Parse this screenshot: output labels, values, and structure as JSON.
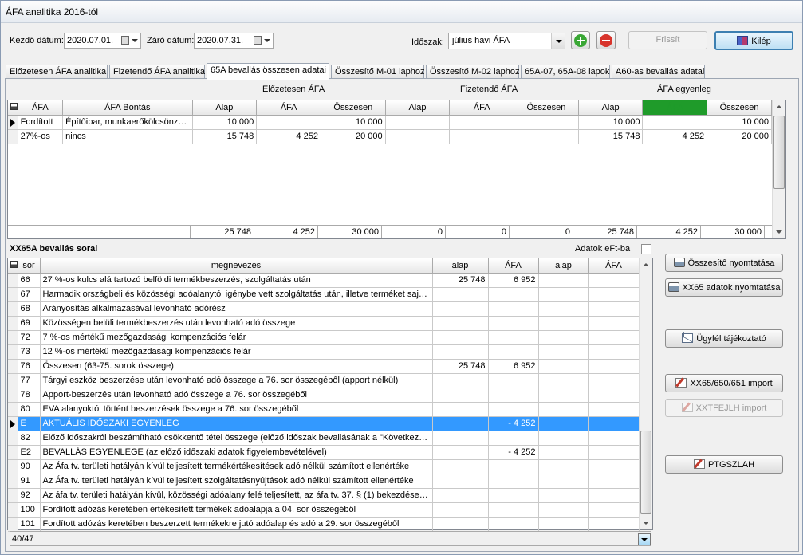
{
  "window": {
    "title": "ÁFA analitika 2016-tól"
  },
  "toolbar": {
    "start_label": "Kezdő dátum:",
    "start_value": "2020.07.01.",
    "end_label": "Záró dátum:",
    "end_value": "2020.07.31.",
    "period_label": "Időszak:",
    "period_value": "július havi ÁFA",
    "refresh_label": "Frissít",
    "exit_label": "Kilép"
  },
  "tabs": [
    "Előzetesen ÁFA analitika",
    "Fizetendő ÁFA analitika",
    "65A bevallás összesen adatai",
    "Összesítő M-01 laphoz",
    "Összesítő M-02 laphoz",
    "65A-07, 65A-08 lapok",
    "A60-as bevallás adatai"
  ],
  "upper": {
    "group_headers": [
      "Előzetesen ÁFA",
      "Fizetendő ÁFA",
      "ÁFA egyenleg"
    ],
    "columns": [
      "ÁFA",
      "ÁFA Bontás",
      "Alap",
      "ÁFA",
      "Összesen",
      "Alap",
      "ÁFA",
      "Összesen",
      "Alap",
      "ÁFA",
      "Összesen"
    ],
    "rows": [
      [
        "Fordított",
        "Építőipar, munkaerőkölcsönzés...",
        "10 000",
        "",
        "10 000",
        "",
        "",
        "",
        "10 000",
        "",
        "10 000"
      ],
      [
        "27%-os",
        "nincs",
        "15 748",
        "4 252",
        "20 000",
        "",
        "",
        "",
        "15 748",
        "4 252",
        "20 000"
      ]
    ],
    "totals": [
      "25 748",
      "4 252",
      "30 000",
      "0",
      "0",
      "0",
      "25 748",
      "4 252",
      "30 000"
    ]
  },
  "lower": {
    "title": "XX65A bevallás sorai",
    "eft_label": "Adatok eFt-ba",
    "columns": [
      "sor",
      "megnevezés",
      "alap",
      "ÁFA",
      "alap",
      "ÁFA"
    ],
    "rows": [
      [
        "66",
        "27 %-os kulcs alá tartozó belföldi termékbeszerzés, szolgáltatás után",
        "25 748",
        "6 952",
        "",
        ""
      ],
      [
        "67",
        "Harmadik országbeli és közösségi adóalanytól igénybe vett szolgáltatás után, illetve terméket saját n...",
        "",
        "",
        "",
        ""
      ],
      [
        "68",
        "Arányosítás alkalmazásával levonható adórész",
        "",
        "",
        "",
        ""
      ],
      [
        "69",
        "Közösségen belüli termékbeszerzés után levonható adó összege",
        "",
        "",
        "",
        ""
      ],
      [
        "72",
        "7 %-os mértékű mezőgazdasági kompenzációs felár",
        "",
        "",
        "",
        ""
      ],
      [
        "73",
        "12 %-os mértékű mezőgazdasági kompenzációs felár",
        "",
        "",
        "",
        ""
      ],
      [
        "76",
        "Összesen (63-75. sorok összege)",
        "25 748",
        "6 952",
        "",
        ""
      ],
      [
        "77",
        "Tárgyi eszköz beszerzése után levonható adó összege a 76. sor összegéből (apport nélkül)",
        "",
        "",
        "",
        ""
      ],
      [
        "78",
        "Apport-beszerzés után levonható adó összege a 76. sor összegéből",
        "",
        "",
        "",
        ""
      ],
      [
        "80",
        "EVA alanyoktól történt beszerzések összege a 76. sor összegéből",
        "",
        "",
        "",
        ""
      ],
      [
        "E",
        "AKTUÁLIS IDŐSZAKI EGYENLEG",
        "",
        "- 4 252",
        "",
        ""
      ],
      [
        "82",
        "Előző időszakról beszámítható csökkentő tétel összege (előző időszak bevallásának a \"Következő i...",
        "",
        "",
        "",
        ""
      ],
      [
        "E2",
        "BEVALLÁS EGYENLEGE (az előző időszaki adatok figyelembevételével)",
        "",
        "- 4 252",
        "",
        ""
      ],
      [
        "90",
        "Az Áfa tv. területi hatályán kívül teljesített termékértékesítések adó nélkül számított ellenértéke",
        "",
        "",
        "",
        ""
      ],
      [
        "91",
        "Az Áfa tv. területi hatályán kívül teljesített szolgáltatásnyújtások adó nélkül számított ellenértéke",
        "",
        "",
        "",
        ""
      ],
      [
        "92",
        "Az áfa tv. területi hatályán kívül, közösségi adóalany felé teljesített, az áfa tv. 37. § (1) bekezdése al...",
        "",
        "",
        "",
        ""
      ],
      [
        "100",
        "Fordított adózás keretében értékesített termékek adóalapja a 04. sor összegéből",
        "",
        "",
        "",
        ""
      ],
      [
        "101",
        "Fordított adózás keretében beszerzett termékekre jutó adóalap és adó a 29. sor összegéből",
        "",
        "",
        "",
        ""
      ]
    ],
    "selected_index": 10,
    "status": "40/47"
  },
  "side_buttons": {
    "summary_print": "Összesítő nyomtatása",
    "xx65_print": "XX65 adatok nyomtatása",
    "client_info": "Ügyfél tájékoztató",
    "xx65_import": "XX65/650/651 import",
    "xxtfejlh_import": "XXTFEJLH import",
    "ptgszlah": "PTGSZLAH"
  }
}
